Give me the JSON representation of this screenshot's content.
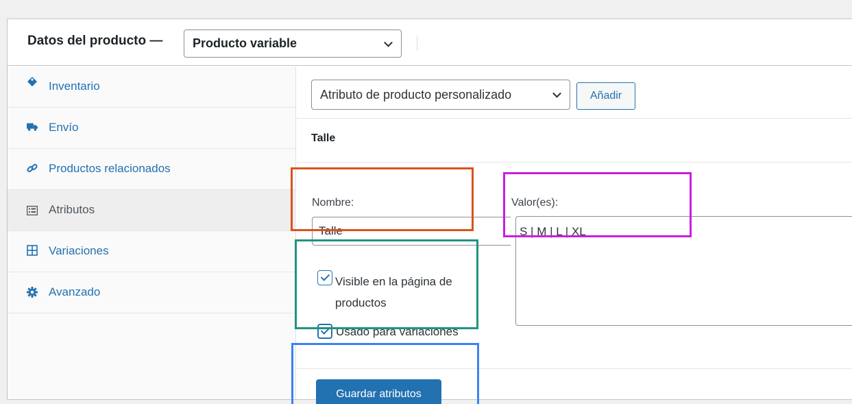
{
  "header": {
    "title": "Datos del producto —",
    "product_type": "Producto variable"
  },
  "tabs": [
    {
      "label": "Inventario",
      "icon": "tag-icon",
      "active": false
    },
    {
      "label": "Envío",
      "icon": "truck-icon",
      "active": false
    },
    {
      "label": "Productos relacionados",
      "icon": "link-icon",
      "active": false
    },
    {
      "label": "Atributos",
      "icon": "list-icon",
      "active": true
    },
    {
      "label": "Variaciones",
      "icon": "grid-icon",
      "active": false
    },
    {
      "label": "Avanzado",
      "icon": "gear-icon",
      "active": false
    }
  ],
  "attributes": {
    "select_value": "Atributo de producto personalizado",
    "add_label": "Añadir",
    "attribute_title": "Talle",
    "name_label": "Nombre:",
    "name_value": "Talle",
    "values_label": "Valor(es):",
    "values_value": "S | M | L | XL",
    "visible_label": "Visible en la página de productos",
    "visible_checked": true,
    "variations_label": "Usado para variaciones",
    "variations_checked": true,
    "save_label": "Guardar atributos"
  },
  "colors": {
    "accent": "#2271b1",
    "annotation_name": "#d9531e",
    "annotation_values": "#c91ee0",
    "annotation_checkboxes": "#1f9480",
    "annotation_save": "#3b82f6"
  }
}
